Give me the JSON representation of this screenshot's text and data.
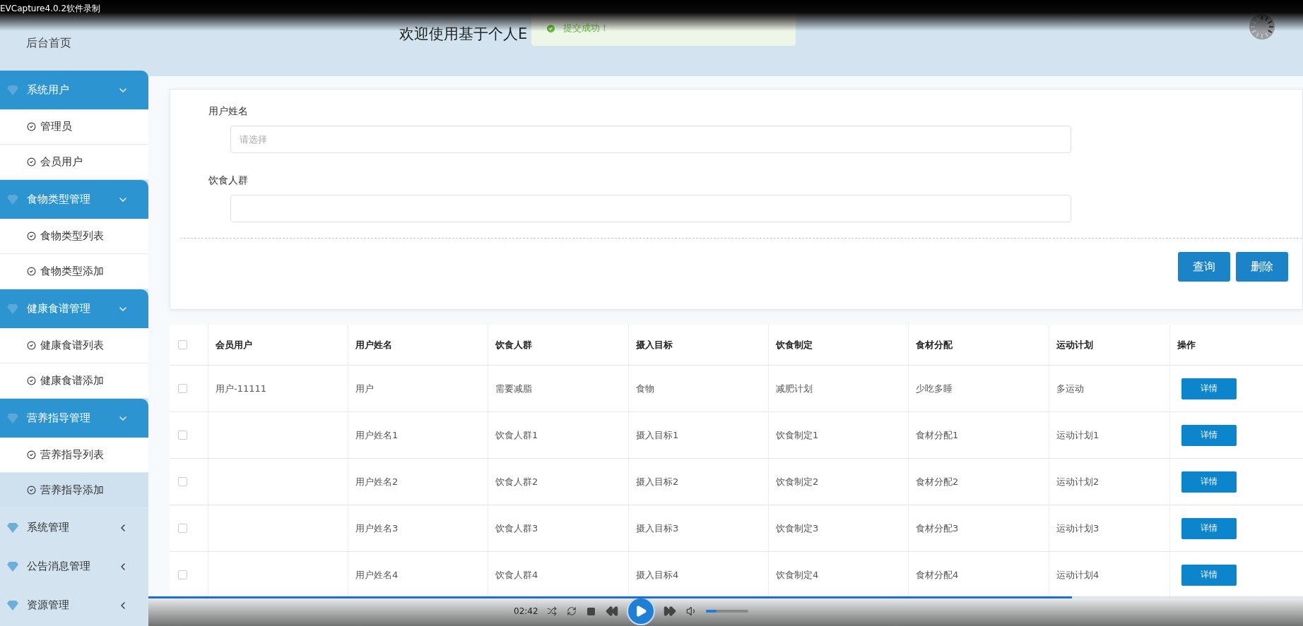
{
  "recorder": {
    "title": "EVCapture4.0.2软件录制"
  },
  "sidebar": {
    "home": "后台首页",
    "groups": [
      {
        "label": "系统用户",
        "expanded": true,
        "items": [
          {
            "label": "管理员",
            "selected": false
          },
          {
            "label": "会员用户",
            "selected": false
          }
        ]
      },
      {
        "label": "食物类型管理",
        "expanded": true,
        "items": [
          {
            "label": "食物类型列表",
            "selected": false
          },
          {
            "label": "食物类型添加",
            "selected": false
          }
        ]
      },
      {
        "label": "健康食谱管理",
        "expanded": true,
        "items": [
          {
            "label": "健康食谱列表",
            "selected": false
          },
          {
            "label": "健康食谱添加",
            "selected": false
          }
        ]
      },
      {
        "label": "营养指导管理",
        "expanded": true,
        "items": [
          {
            "label": "营养指导列表",
            "selected": false
          },
          {
            "label": "营养指导添加",
            "selected": true
          }
        ]
      },
      {
        "label": "系统管理",
        "expanded": false
      },
      {
        "label": "公告消息管理",
        "expanded": false
      },
      {
        "label": "资源管理",
        "expanded": false
      }
    ]
  },
  "header": {
    "title": "欢迎使用基于个人E"
  },
  "toast": {
    "message": "提交成功！"
  },
  "form": {
    "fields": [
      {
        "label": "用户姓名",
        "placeholder": "请选择"
      },
      {
        "label": "饮食人群"
      }
    ],
    "buttons": [
      "查询",
      "删除"
    ]
  },
  "table": {
    "select_all": {
      "checked": false
    },
    "columns": [
      "会员用户",
      "用户姓名",
      "饮食人群",
      "摄入目标",
      "饮食制定",
      "食材分配",
      "运动计划",
      "操作"
    ],
    "rows": [
      {
        "checked": false,
        "cells": [
          "用户-11111",
          "用户",
          "需要减脂",
          "食物",
          "减肥计划",
          "少吃多睡",
          "多运动"
        ],
        "action": "详情"
      },
      {
        "checked": false,
        "cells": [
          "",
          "用户姓名1",
          "饮食人群1",
          "摄入目标1",
          "饮食制定1",
          "食材分配1",
          "运动计划1"
        ],
        "action": "详情"
      },
      {
        "checked": false,
        "cells": [
          "",
          "用户姓名2",
          "饮食人群2",
          "摄入目标2",
          "饮食制定2",
          "食材分配2",
          "运动计划2"
        ],
        "action": "详情"
      },
      {
        "checked": false,
        "cells": [
          "",
          "用户姓名3",
          "饮食人群3",
          "摄入目标3",
          "饮食制定3",
          "食材分配3",
          "运动计划3"
        ],
        "action": "详情"
      },
      {
        "checked": false,
        "cells": [
          "",
          "用户姓名4",
          "饮食人群4",
          "摄入目标4",
          "饮食制定4",
          "食材分配4",
          "运动计划4"
        ],
        "action": "详情"
      }
    ]
  },
  "player": {
    "time": "02:42",
    "progress": {
      "level": 0.8
    },
    "volume": {
      "level": 0.25
    }
  }
}
